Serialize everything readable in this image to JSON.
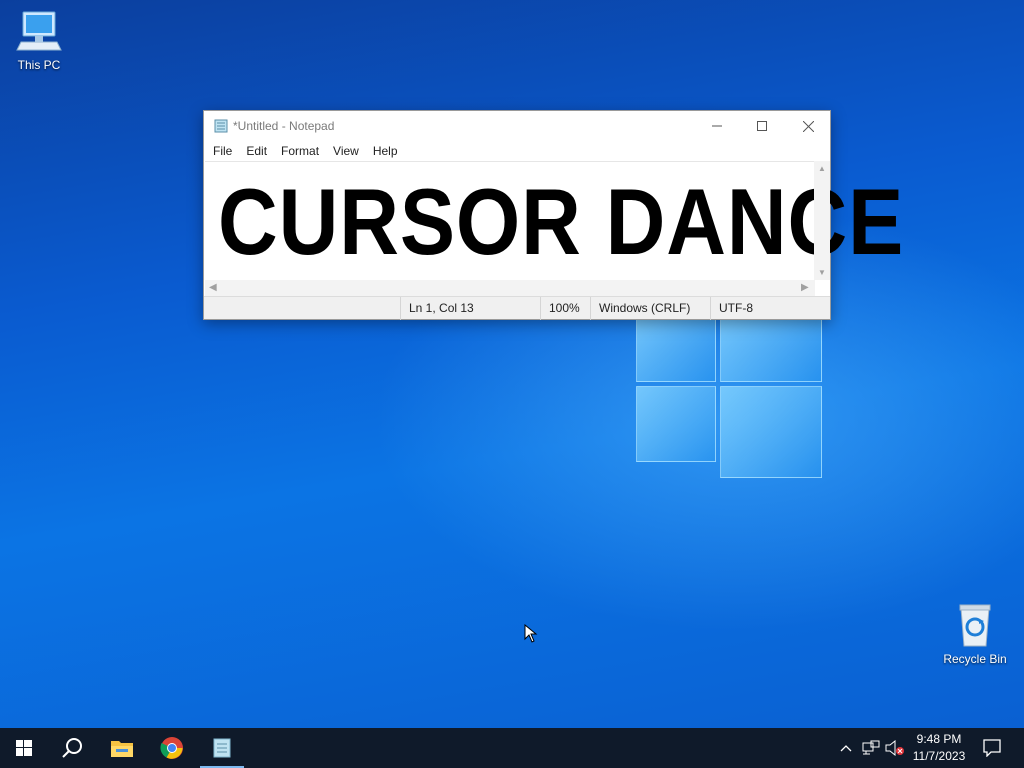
{
  "desktop": {
    "icons": [
      {
        "label": "This PC",
        "icon": "this-pc-icon"
      },
      {
        "label": "Recycle Bin",
        "icon": "recycle-bin-icon"
      }
    ]
  },
  "notepad": {
    "title": "*Untitled - Notepad",
    "menu": [
      "File",
      "Edit",
      "Format",
      "View",
      "Help"
    ],
    "content": "CURSOR DANCE",
    "status": {
      "position": "Ln 1, Col 13",
      "zoom": "100%",
      "line_endings": "Windows (CRLF)",
      "encoding": "UTF-8"
    }
  },
  "taskbar": {
    "apps": [
      "start-icon",
      "search-icon",
      "file-explorer-icon",
      "chrome-icon",
      "notepad-icon"
    ],
    "active_app": "notepad-icon",
    "clock": {
      "time": "9:48 PM",
      "date": "11/7/2023"
    },
    "tray": [
      "chevron-up-icon",
      "network-icon",
      "volume-muted-icon",
      "notification-icon"
    ]
  },
  "colors": {
    "desktop_blue": "#0a62d0",
    "taskbar": "#0f1a2a",
    "active_indicator": "#7db9f0"
  }
}
